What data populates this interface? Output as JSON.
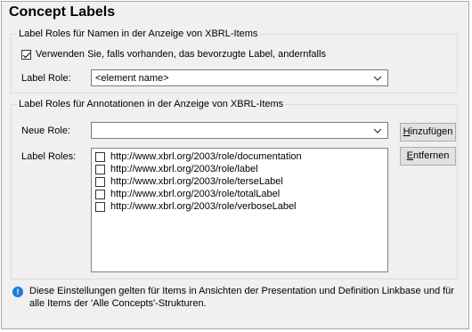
{
  "title": "Concept Labels",
  "group_names": {
    "legend": "Label Roles für Namen in der Anzeige von XBRL-Items",
    "checkbox_label": "Verwenden Sie, falls vorhanden, das bevorzugte Label, andernfalls",
    "checkbox_checked": true,
    "label_role_label": "Label Role:",
    "label_role_value": "<element name>"
  },
  "group_annotations": {
    "legend": "Label Roles für Annotationen in der Anzeige von XBRL-Items",
    "new_role_label": "Neue Role:",
    "new_role_value": "",
    "add_button": "Hinzufügen",
    "remove_button": "Entfernen",
    "label_roles_label": "Label Roles:",
    "roles": [
      "http://www.xbrl.org/2003/role/documentation",
      "http://www.xbrl.org/2003/role/label",
      "http://www.xbrl.org/2003/role/terseLabel",
      "http://www.xbrl.org/2003/role/totalLabel",
      "http://www.xbrl.org/2003/role/verboseLabel"
    ]
  },
  "info": {
    "icon": "info-icon",
    "text_line1": "Diese Einstellungen gelten für Items in Ansichten der Presentation und Definition Linkbase und für",
    "text_line2": "alle Items der 'Alle Concepts'-Strukturen."
  },
  "colors": {
    "background": "#f0f0f0",
    "info_icon": "#1e7bd8"
  }
}
